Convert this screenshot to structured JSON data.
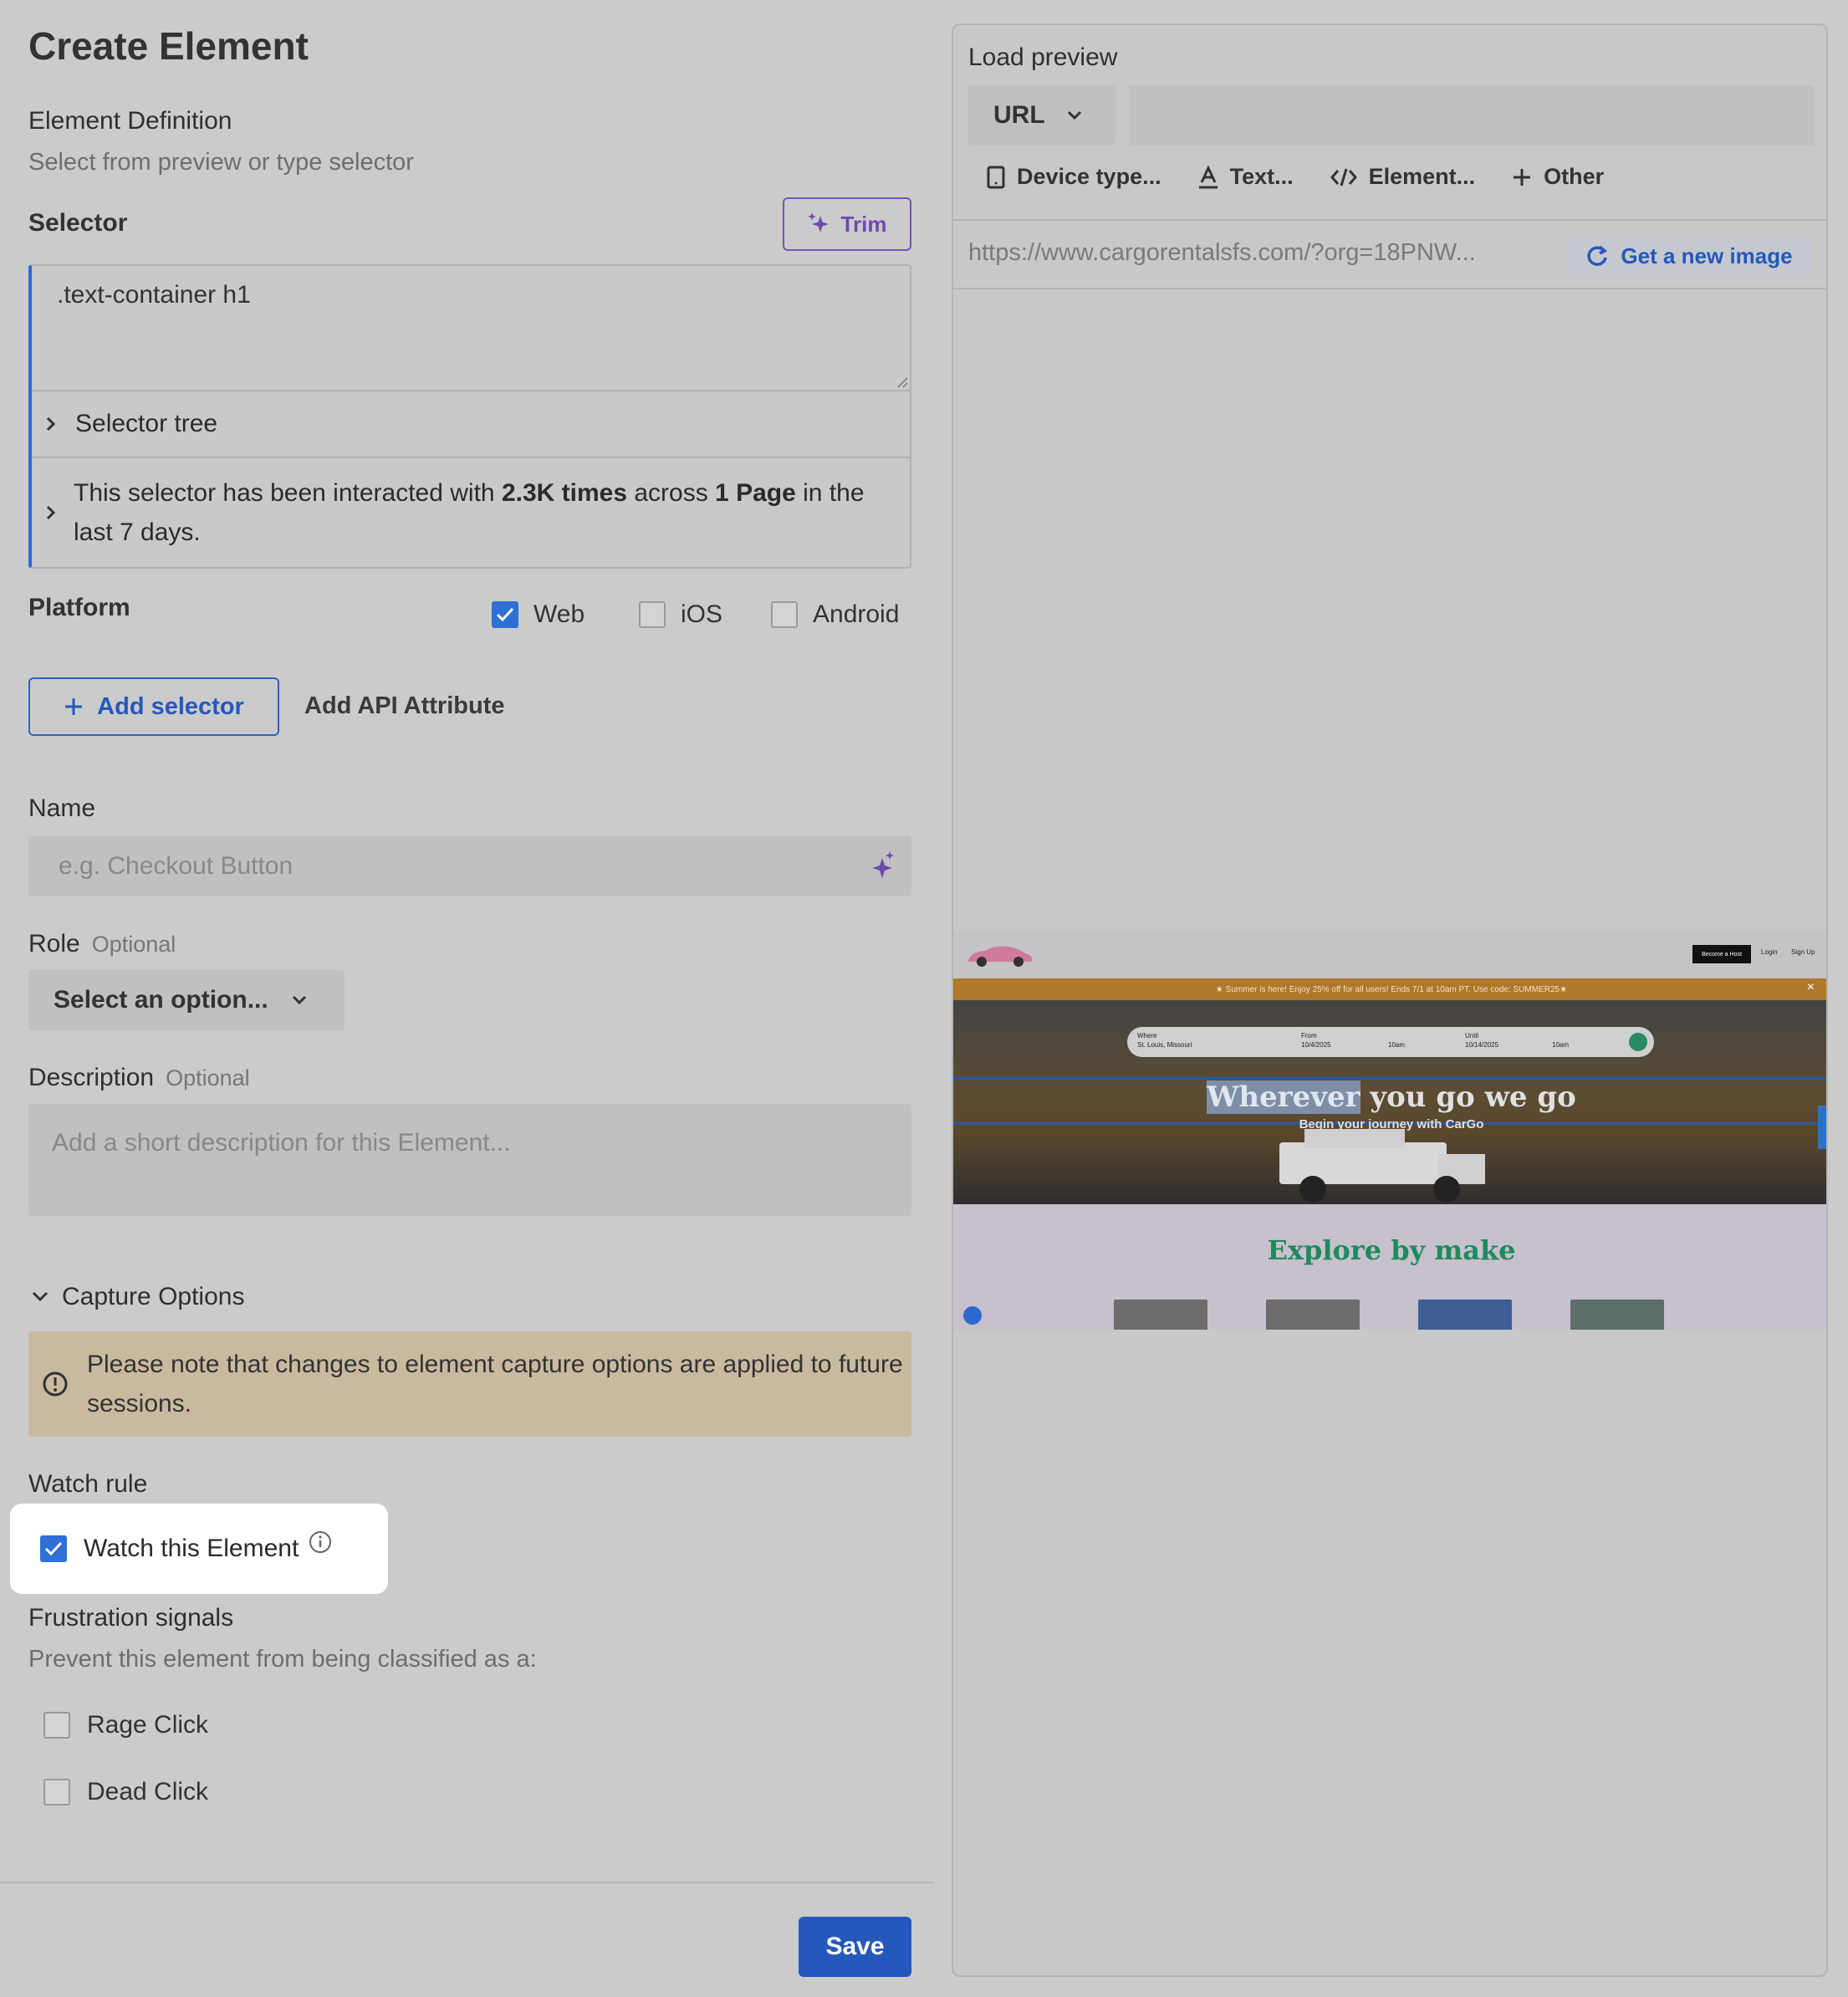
{
  "page": {
    "title": "Create Element"
  },
  "definition": {
    "label": "Element Definition",
    "hint": "Select from preview or type selector"
  },
  "selector": {
    "label": "Selector",
    "trim_label": "Trim",
    "value": ".text-container h1",
    "tree_label": "Selector tree",
    "info": {
      "prefix": "This selector has been interacted with ",
      "times": "2.3K times",
      "middle": " across ",
      "pages": "1 Page",
      "suffix": " in the last 7 days."
    }
  },
  "platform": {
    "label": "Platform",
    "options": [
      {
        "label": "Web",
        "checked": true
      },
      {
        "label": "iOS",
        "checked": false
      },
      {
        "label": "Android",
        "checked": false
      }
    ]
  },
  "actions": {
    "add_selector": "Add selector",
    "add_api_attribute": "Add API Attribute"
  },
  "name": {
    "label": "Name",
    "placeholder": "e.g. Checkout Button"
  },
  "role": {
    "label": "Role",
    "optional": "Optional",
    "value": "Select an option..."
  },
  "description": {
    "label": "Description",
    "optional": "Optional",
    "placeholder": "Add a short description for this Element..."
  },
  "capture": {
    "label": "Capture Options",
    "notice": "Please note that changes to element capture options are applied to future sessions."
  },
  "watch": {
    "label": "Watch rule",
    "checkbox_label": "Watch this Element",
    "checked": true
  },
  "frustration": {
    "label": "Frustration signals",
    "hint": "Prevent this element from being classified as a:",
    "options": [
      {
        "label": "Rage Click",
        "checked": false
      },
      {
        "label": "Dead Click",
        "checked": false
      }
    ]
  },
  "footer": {
    "save": "Save"
  },
  "preview": {
    "title": "Load preview",
    "source": "URL",
    "toolbar": [
      "Device type...",
      "Text...",
      "Element...",
      "Other"
    ],
    "url": "https://www.cargorentalsfs.com/?org=18PNW...",
    "new_image": "Get a new image",
    "site": {
      "nav": [
        "Become a Host",
        "Login",
        "Sign Up"
      ],
      "banner": "★ Summer is here! Enjoy 25% off for all users! Ends 7/1 at 10am PT. Use code: SUMMER25★",
      "search": {
        "where_label": "Where",
        "where": "St. Louis, Missouri",
        "from_label": "From",
        "from": "10/4/2025",
        "from_time": "10am",
        "until_label": "Until",
        "until": "10/14/2025",
        "until_time": "10am"
      },
      "hero_title_highlight": "Wherever",
      "hero_title_rest": " you go we go",
      "hero_sub": "Begin your journey with CarGo",
      "explore": "Explore by make"
    }
  },
  "colors": {
    "accent": "#2458bc",
    "ai_purple": "#7248b0",
    "notice_bg": "#c9b99f",
    "explore_green": "#1e8a5c"
  }
}
